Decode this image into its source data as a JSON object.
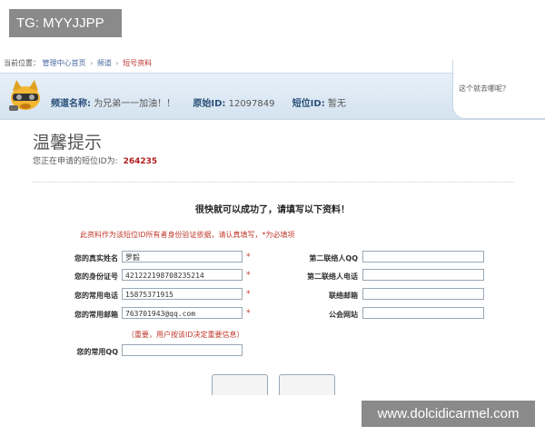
{
  "watermark_tag": "TG: MYYJJPP",
  "watermark_url": "www.dolcidicarmel.com",
  "breadcrumb": {
    "prefix": "当前位置：",
    "items": [
      "管理中心首页",
      "频道",
      "短号资料"
    ]
  },
  "header": {
    "channel_name_label": "频道名称:",
    "channel_name_value": "为兄弟一一加油！！",
    "original_id_label": "原始ID:",
    "original_id_value": "12097849",
    "short_id_label": "短位ID:",
    "short_id_value": "暂无",
    "qq_link": "这个就去哪呢？"
  },
  "tip": {
    "title": "温馨提示",
    "line_text": "您正在申请的短位ID为:",
    "short_id": "264235"
  },
  "form": {
    "welcome": "很快就可以成功了，请填写以下资料！",
    "notice": "此资料作为该短位ID所有者身份验证依据，请认真填写，*为必填项",
    "real_name_label": "您的真实姓名",
    "real_name_value": "罗毅",
    "id_number_label": "您的身份证号",
    "id_number_value": "421222198708235214",
    "phone_label": "您的常用电话",
    "phone_value": "15875371915",
    "email_label": "您的常用邮箱",
    "email_value": "763701943@qq.com",
    "qq_label": "您的常用QQ",
    "qq_value": "",
    "contact2_qq_label": "第二联络人QQ",
    "contact2_qq_value": "",
    "contact2_phone_label": "第二联络人电话",
    "contact2_phone_value": "",
    "contact_email_label": "联络邮箱",
    "contact_email_value": "",
    "guild_site_label": "公会网站",
    "guild_site_value": "",
    "required_mark": "*",
    "important_note": "（重要，用户按该ID决定重要信息）"
  }
}
